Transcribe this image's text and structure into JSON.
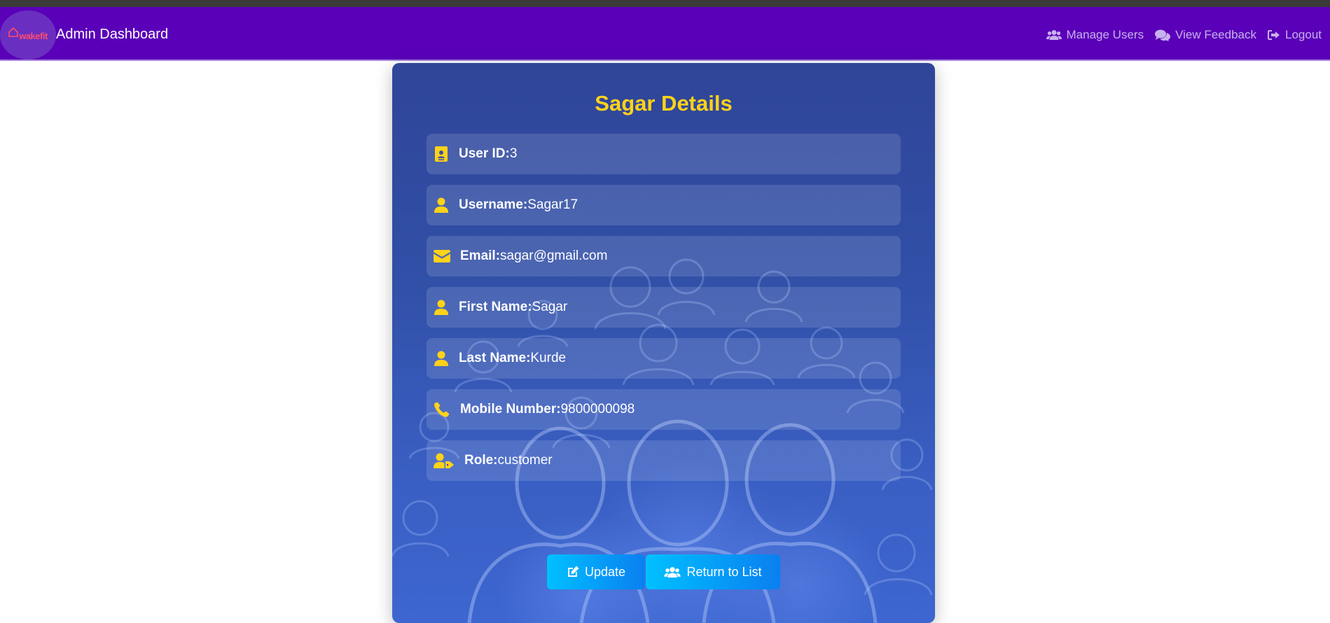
{
  "app": {
    "logo_text": "wakefit",
    "title": "Admin Dashboard"
  },
  "nav": {
    "links": [
      {
        "label": "Manage Users",
        "icon": "users-icon"
      },
      {
        "label": "View Feedback",
        "icon": "comments-icon"
      },
      {
        "label": "Logout",
        "icon": "logout-icon"
      }
    ]
  },
  "details": {
    "title": "Sagar Details",
    "fields": [
      {
        "label": "User ID:",
        "value": "3",
        "icon": "id-card-icon"
      },
      {
        "label": "Username:",
        "value": "Sagar17",
        "icon": "user-icon"
      },
      {
        "label": "Email:",
        "value": "sagar@gmail.com",
        "icon": "envelope-icon"
      },
      {
        "label": "First Name:",
        "value": "Sagar",
        "icon": "user-icon"
      },
      {
        "label": "Last Name:",
        "value": "Kurde",
        "icon": "user-icon"
      },
      {
        "label": "Mobile Number:",
        "value": "9800000098",
        "icon": "phone-icon"
      },
      {
        "label": "Role:",
        "value": "customer",
        "icon": "user-tag-icon"
      }
    ]
  },
  "actions": {
    "update_label": "Update",
    "return_label": "Return to List"
  },
  "colors": {
    "navbar": "#5a00b8",
    "accent": "#ffd21a",
    "button": "#00c0ff"
  }
}
